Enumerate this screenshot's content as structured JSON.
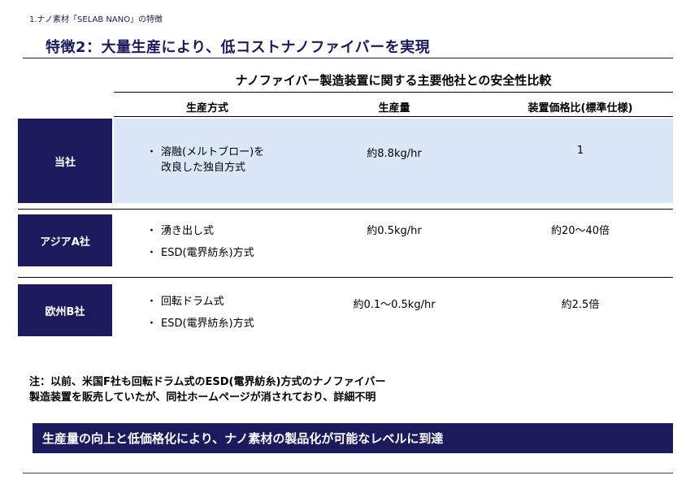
{
  "breadcrumb": "1.ナノ素材「SELAB NANO」の特徴",
  "page_title": "特徴2：大量生産により、低コストナノファイバーを実現",
  "table": {
    "caption": "ナノファイバー製造装置に関する主要他社との安全性比較",
    "headers": [
      "生産方式",
      "生産量",
      "装置価格比(標準仕様)"
    ],
    "rows": [
      {
        "label": "当社",
        "method_lines": [
          "溶融(メルトブロー)を",
          "改良した独自方式"
        ],
        "output": "約8.8kg/hr",
        "price_ratio": "1"
      },
      {
        "label": "アジアA社",
        "method_items": [
          "湧き出し式",
          "ESD(電界紡糸)方式"
        ],
        "output": "約0.5kg/hr",
        "price_ratio": "約20～40倍"
      },
      {
        "label": "欧州B社",
        "method_items": [
          "回転ドラム式",
          "ESD(電界紡糸)方式"
        ],
        "output": "約0.1～0.5kg/hr",
        "price_ratio": "約2.5倍"
      }
    ]
  },
  "note_lines": [
    "注：以前、米国F社も回転ドラム式のESD(電界紡糸)方式のナノファイバー",
    "製造装置を販売していたが、同社ホームページが消されており、詳細不明"
  ],
  "banner": "生産量の向上と低価格化により、ナノ素材の製品化が可能なレベルに到達",
  "bullet_char": "・",
  "colors": {
    "navy": "#1a1a5c",
    "highlight": "#d9e7f8"
  }
}
